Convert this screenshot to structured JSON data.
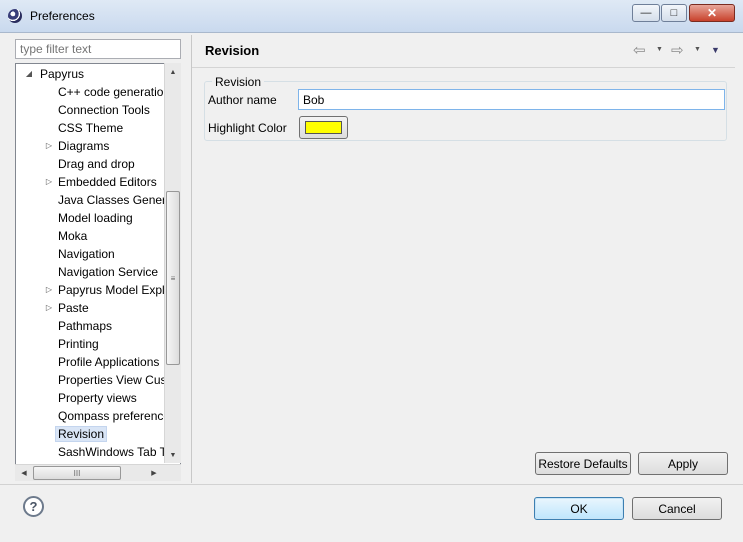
{
  "window": {
    "title": "Preferences",
    "minimize": "—",
    "maximize": "□",
    "close": "✕"
  },
  "filter": {
    "placeholder": "type filter text"
  },
  "tree": {
    "items": [
      {
        "label": "Papyrus",
        "expander": "◢",
        "level": 0
      },
      {
        "label": "C++ code generatio",
        "expander": "",
        "level": 1
      },
      {
        "label": "Connection Tools",
        "expander": "",
        "level": 1
      },
      {
        "label": "CSS Theme",
        "expander": "",
        "level": 1
      },
      {
        "label": "Diagrams",
        "expander": "▷",
        "level": 1
      },
      {
        "label": "Drag and drop",
        "expander": "",
        "level": 1
      },
      {
        "label": "Embedded Editors",
        "expander": "▷",
        "level": 1
      },
      {
        "label": "Java Classes Generat",
        "expander": "",
        "level": 1
      },
      {
        "label": "Model loading",
        "expander": "",
        "level": 1
      },
      {
        "label": "Moka",
        "expander": "",
        "level": 1
      },
      {
        "label": "Navigation",
        "expander": "",
        "level": 1
      },
      {
        "label": "Navigation Service",
        "expander": "",
        "level": 1
      },
      {
        "label": "Papyrus Model Explo",
        "expander": "▷",
        "level": 1
      },
      {
        "label": "Paste",
        "expander": "▷",
        "level": 1
      },
      {
        "label": "Pathmaps",
        "expander": "",
        "level": 1
      },
      {
        "label": "Printing",
        "expander": "",
        "level": 1
      },
      {
        "label": "Profile Applications",
        "expander": "",
        "level": 1
      },
      {
        "label": "Properties View Cust",
        "expander": "",
        "level": 1
      },
      {
        "label": "Property views",
        "expander": "",
        "level": 1
      },
      {
        "label": "Qompass preference",
        "expander": "",
        "level": 1
      },
      {
        "label": "Revision",
        "expander": "",
        "level": 1,
        "selected": true
      },
      {
        "label": "SashWindows Tab T",
        "expander": "",
        "level": 1
      }
    ],
    "scroll_up": "▲",
    "scroll_down": "▼",
    "scroll_left": "◀",
    "scroll_right": "▶",
    "thumb_grip_v": "≡",
    "thumb_grip_h": "III"
  },
  "page": {
    "title": "Revision",
    "nav": {
      "back_icon": "⇦",
      "forward_icon": "⇨",
      "dropdown_icon": "▼",
      "menu_icon": "▼"
    },
    "group": {
      "legend": "Revision",
      "author_label": "Author name",
      "author_value": "Bob",
      "color_label": "Highlight Color",
      "color_value": "#ffff00"
    },
    "restore_defaults": "Restore Defaults",
    "apply": "Apply"
  },
  "footer": {
    "help": "?",
    "ok": "OK",
    "cancel": "Cancel"
  }
}
